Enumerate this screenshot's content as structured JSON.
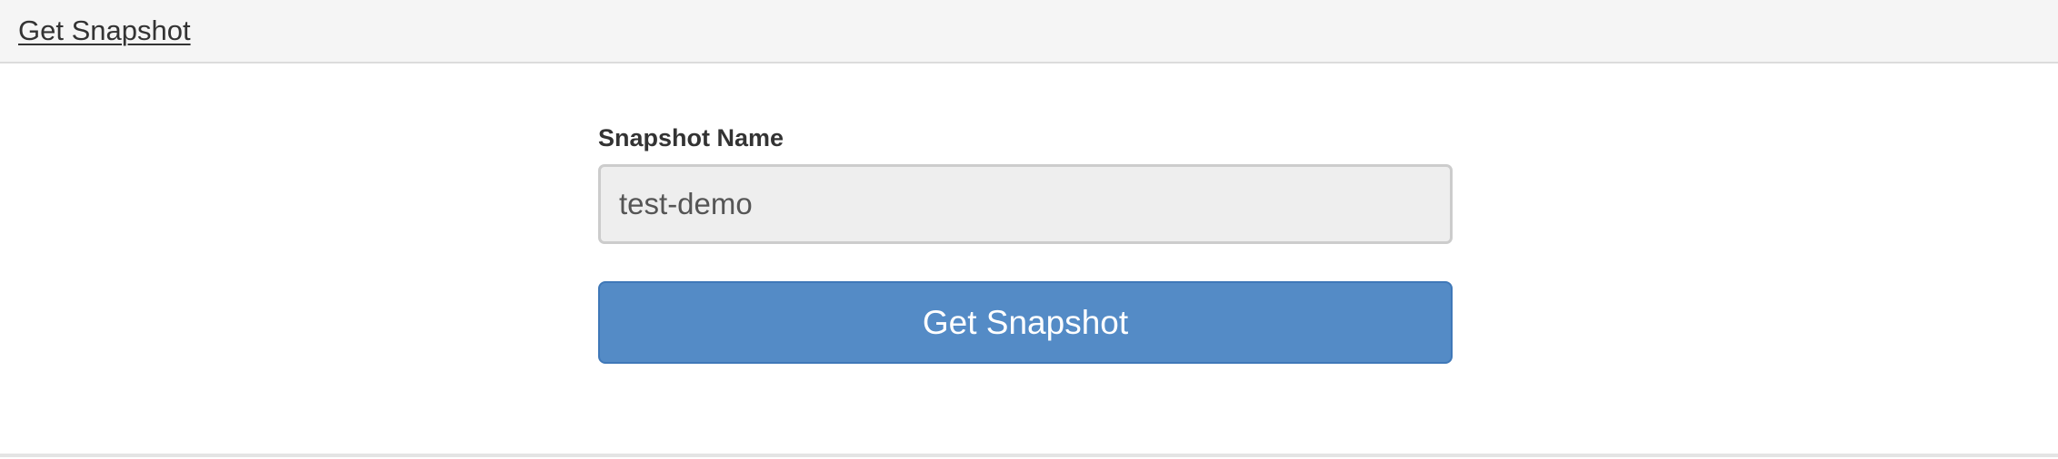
{
  "header": {
    "title_link": "Get Snapshot"
  },
  "form": {
    "snapshot_name_label": "Snapshot Name",
    "snapshot_name_value": "test-demo",
    "submit_label": "Get Snapshot"
  },
  "colors": {
    "header_background": "#f5f5f5",
    "input_background": "#eeeeee",
    "button_background": "#548bc6",
    "button_text": "#ffffff"
  }
}
